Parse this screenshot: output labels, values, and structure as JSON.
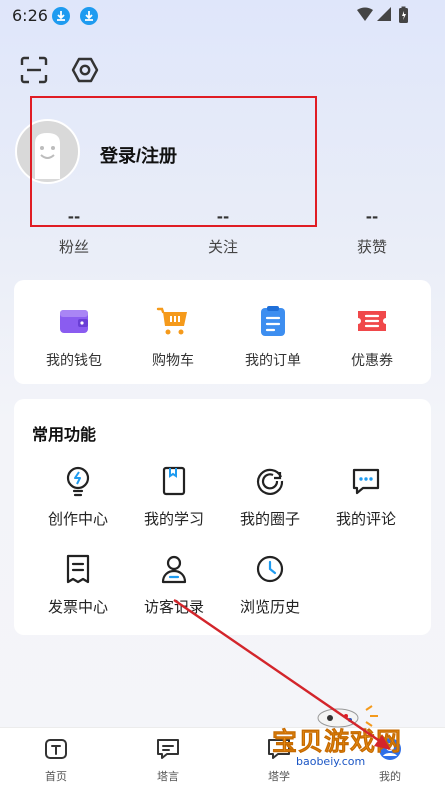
{
  "status_bar": {
    "time": "6:26"
  },
  "header": {
    "scan_icon": "scan-icon",
    "settings_icon": "hexagon-settings-icon"
  },
  "profile": {
    "login_label": "登录/注册"
  },
  "stats": [
    {
      "value": "--",
      "label": "粉丝"
    },
    {
      "value": "--",
      "label": "关注"
    },
    {
      "value": "--",
      "label": "获赞"
    }
  ],
  "quick_actions": [
    {
      "label": "我的钱包",
      "icon": "wallet-icon",
      "color": "#8a5cf0"
    },
    {
      "label": "购物车",
      "icon": "cart-icon",
      "color": "#f59a1b"
    },
    {
      "label": "我的订单",
      "icon": "order-icon",
      "color": "#3d8ef0"
    },
    {
      "label": "优惠券",
      "icon": "coupon-icon",
      "color": "#f0484a"
    }
  ],
  "common_functions": {
    "title": "常用功能",
    "items": [
      {
        "label": "创作中心",
        "icon": "lightbulb-icon"
      },
      {
        "label": "我的学习",
        "icon": "book-icon"
      },
      {
        "label": "我的圈子",
        "icon": "circle-icon"
      },
      {
        "label": "我的评论",
        "icon": "comment-icon"
      },
      {
        "label": "发票中心",
        "icon": "invoice-icon"
      },
      {
        "label": "访客记录",
        "icon": "visitor-icon"
      },
      {
        "label": "浏览历史",
        "icon": "clock-icon"
      }
    ]
  },
  "tabbar": [
    {
      "label": "首页",
      "icon": "home-icon"
    },
    {
      "label": "塔言",
      "icon": "message-icon"
    },
    {
      "label": "塔学",
      "icon": "learn-icon"
    },
    {
      "label": "我的",
      "icon": "profile-icon"
    }
  ],
  "watermark": {
    "text": "宝贝游戏网",
    "url": "baobeiy.com"
  },
  "colors": {
    "annotation_red": "#e01c24",
    "accent_blue": "#1e9bf0"
  }
}
